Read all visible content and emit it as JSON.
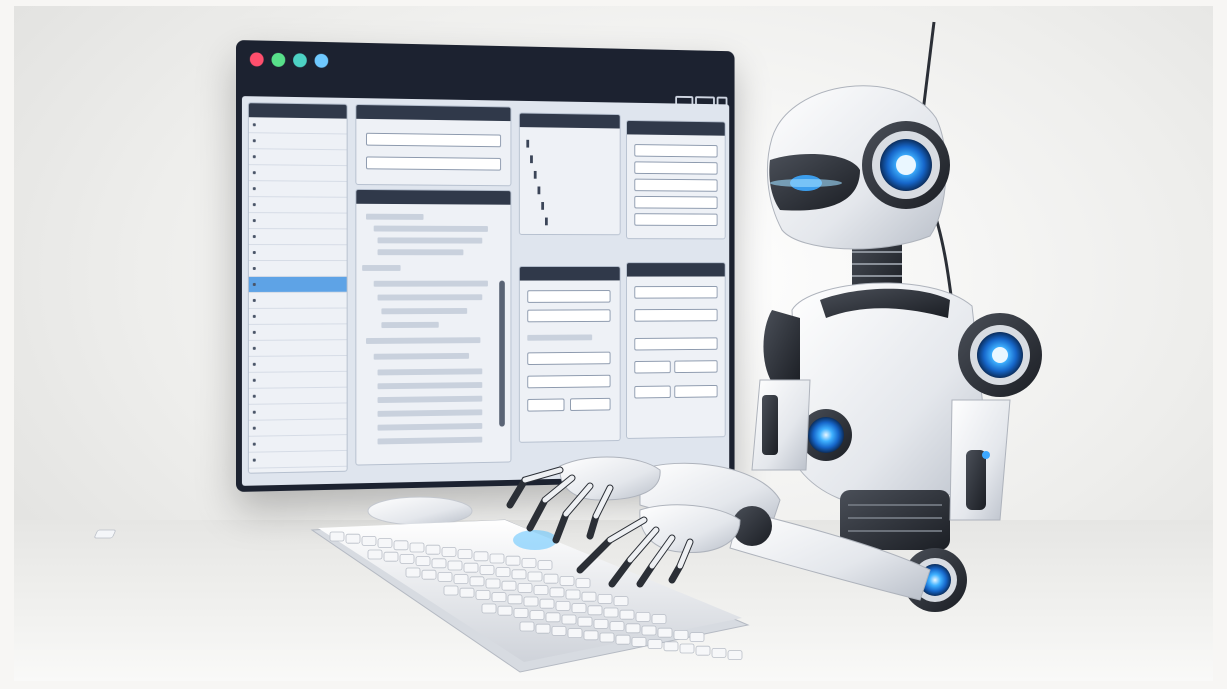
{
  "screen": {
    "left_panel": {
      "rows": [
        "",
        "",
        "",
        "",
        "",
        "",
        "",
        "",
        "",
        "",
        "",
        "",
        "",
        "",
        "",
        "",
        "",
        "",
        "",
        "",
        "",
        "",
        "",
        ""
      ],
      "selected_index": 10
    },
    "middle_label": "",
    "tree_items": [
      "",
      "",
      "",
      "",
      "",
      ""
    ],
    "right_fields": [
      "",
      "",
      "",
      "",
      ""
    ]
  },
  "colors": {
    "bezel": "#1c2230",
    "accent_glow": "#3da8ff",
    "selection": "#5ea3e6",
    "dot_red": "#ff4f6d",
    "dot_green": "#58e08a",
    "dot_teal": "#4dd2c4",
    "dot_blue": "#6fc9ff"
  },
  "icons": [
    "window-minimize-icon",
    "window-maximize-icon",
    "window-close-icon"
  ]
}
